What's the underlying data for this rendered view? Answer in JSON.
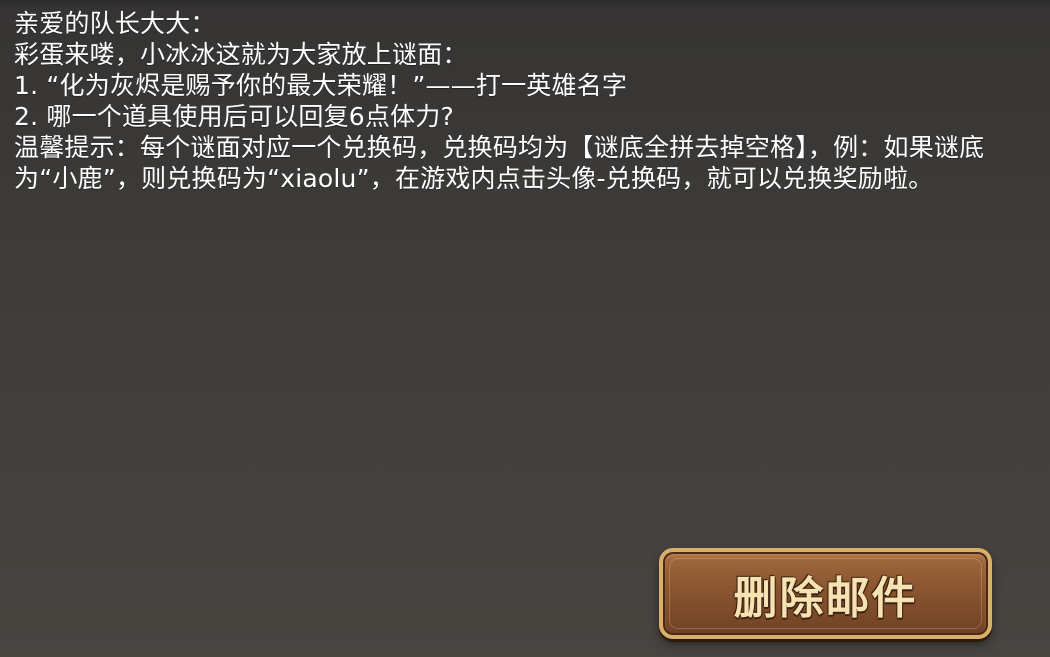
{
  "mail": {
    "greeting": "亲爱的队长大大：",
    "intro": "彩蛋来喽，小冰冰这就为大家放上谜面：",
    "riddle_1": "1. “化为灰烬是赐予你的最大荣耀！”——打一英雄名字",
    "riddle_2": "2. 哪一个道具使用后可以回复6点体力?",
    "tip": "温馨提示：每个谜面对应一个兑换码，兑换码均为【谜底全拼去掉空格】，例：如果谜底为“小鹿”，则兑换码为“xiaolu”，在游戏内点击头像-兑换码，就可以兑换奖励啦。"
  },
  "actions": {
    "delete_label": "删除邮件"
  },
  "colors": {
    "text": "#ffffff",
    "button_face": "#8a5530",
    "button_border": "#d9b06a",
    "button_text": "#f7e2b3"
  }
}
